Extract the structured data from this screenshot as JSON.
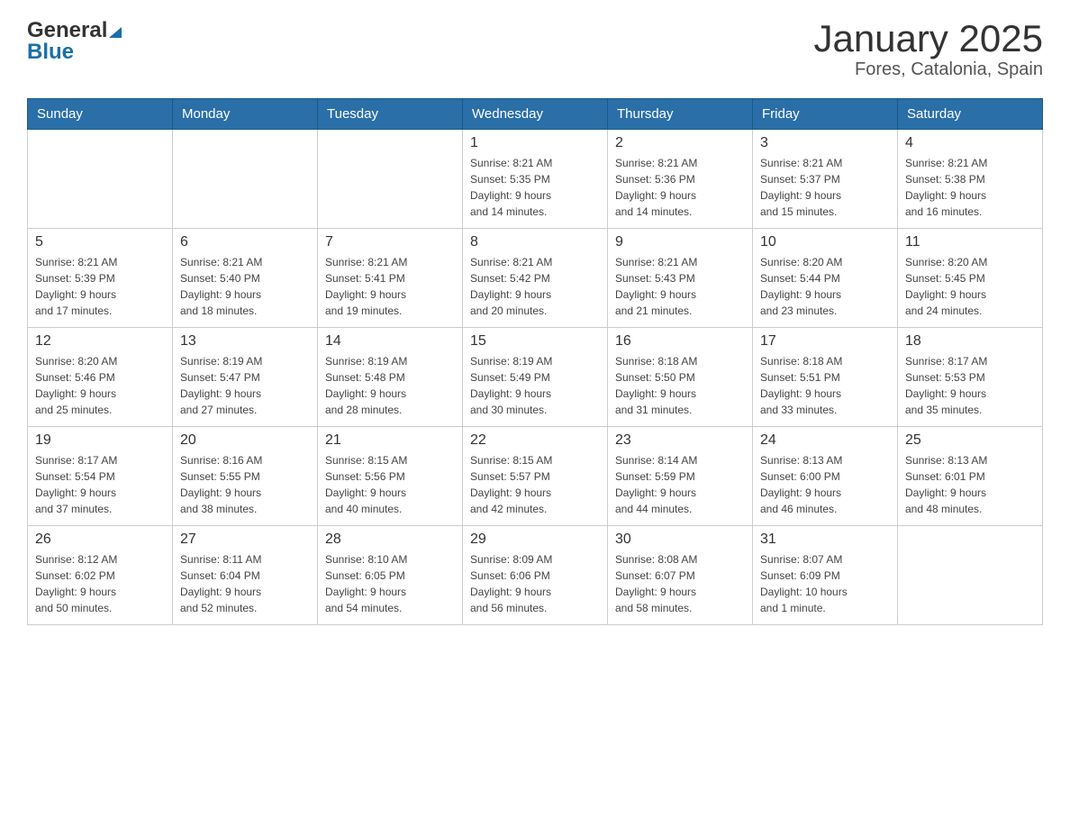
{
  "header": {
    "logo": {
      "general": "General",
      "blue": "Blue"
    },
    "title": "January 2025",
    "subtitle": "Fores, Catalonia, Spain"
  },
  "weekdays": [
    "Sunday",
    "Monday",
    "Tuesday",
    "Wednesday",
    "Thursday",
    "Friday",
    "Saturday"
  ],
  "weeks": [
    [
      {
        "day": "",
        "info": ""
      },
      {
        "day": "",
        "info": ""
      },
      {
        "day": "",
        "info": ""
      },
      {
        "day": "1",
        "info": "Sunrise: 8:21 AM\nSunset: 5:35 PM\nDaylight: 9 hours\nand 14 minutes."
      },
      {
        "day": "2",
        "info": "Sunrise: 8:21 AM\nSunset: 5:36 PM\nDaylight: 9 hours\nand 14 minutes."
      },
      {
        "day": "3",
        "info": "Sunrise: 8:21 AM\nSunset: 5:37 PM\nDaylight: 9 hours\nand 15 minutes."
      },
      {
        "day": "4",
        "info": "Sunrise: 8:21 AM\nSunset: 5:38 PM\nDaylight: 9 hours\nand 16 minutes."
      }
    ],
    [
      {
        "day": "5",
        "info": "Sunrise: 8:21 AM\nSunset: 5:39 PM\nDaylight: 9 hours\nand 17 minutes."
      },
      {
        "day": "6",
        "info": "Sunrise: 8:21 AM\nSunset: 5:40 PM\nDaylight: 9 hours\nand 18 minutes."
      },
      {
        "day": "7",
        "info": "Sunrise: 8:21 AM\nSunset: 5:41 PM\nDaylight: 9 hours\nand 19 minutes."
      },
      {
        "day": "8",
        "info": "Sunrise: 8:21 AM\nSunset: 5:42 PM\nDaylight: 9 hours\nand 20 minutes."
      },
      {
        "day": "9",
        "info": "Sunrise: 8:21 AM\nSunset: 5:43 PM\nDaylight: 9 hours\nand 21 minutes."
      },
      {
        "day": "10",
        "info": "Sunrise: 8:20 AM\nSunset: 5:44 PM\nDaylight: 9 hours\nand 23 minutes."
      },
      {
        "day": "11",
        "info": "Sunrise: 8:20 AM\nSunset: 5:45 PM\nDaylight: 9 hours\nand 24 minutes."
      }
    ],
    [
      {
        "day": "12",
        "info": "Sunrise: 8:20 AM\nSunset: 5:46 PM\nDaylight: 9 hours\nand 25 minutes."
      },
      {
        "day": "13",
        "info": "Sunrise: 8:19 AM\nSunset: 5:47 PM\nDaylight: 9 hours\nand 27 minutes."
      },
      {
        "day": "14",
        "info": "Sunrise: 8:19 AM\nSunset: 5:48 PM\nDaylight: 9 hours\nand 28 minutes."
      },
      {
        "day": "15",
        "info": "Sunrise: 8:19 AM\nSunset: 5:49 PM\nDaylight: 9 hours\nand 30 minutes."
      },
      {
        "day": "16",
        "info": "Sunrise: 8:18 AM\nSunset: 5:50 PM\nDaylight: 9 hours\nand 31 minutes."
      },
      {
        "day": "17",
        "info": "Sunrise: 8:18 AM\nSunset: 5:51 PM\nDaylight: 9 hours\nand 33 minutes."
      },
      {
        "day": "18",
        "info": "Sunrise: 8:17 AM\nSunset: 5:53 PM\nDaylight: 9 hours\nand 35 minutes."
      }
    ],
    [
      {
        "day": "19",
        "info": "Sunrise: 8:17 AM\nSunset: 5:54 PM\nDaylight: 9 hours\nand 37 minutes."
      },
      {
        "day": "20",
        "info": "Sunrise: 8:16 AM\nSunset: 5:55 PM\nDaylight: 9 hours\nand 38 minutes."
      },
      {
        "day": "21",
        "info": "Sunrise: 8:15 AM\nSunset: 5:56 PM\nDaylight: 9 hours\nand 40 minutes."
      },
      {
        "day": "22",
        "info": "Sunrise: 8:15 AM\nSunset: 5:57 PM\nDaylight: 9 hours\nand 42 minutes."
      },
      {
        "day": "23",
        "info": "Sunrise: 8:14 AM\nSunset: 5:59 PM\nDaylight: 9 hours\nand 44 minutes."
      },
      {
        "day": "24",
        "info": "Sunrise: 8:13 AM\nSunset: 6:00 PM\nDaylight: 9 hours\nand 46 minutes."
      },
      {
        "day": "25",
        "info": "Sunrise: 8:13 AM\nSunset: 6:01 PM\nDaylight: 9 hours\nand 48 minutes."
      }
    ],
    [
      {
        "day": "26",
        "info": "Sunrise: 8:12 AM\nSunset: 6:02 PM\nDaylight: 9 hours\nand 50 minutes."
      },
      {
        "day": "27",
        "info": "Sunrise: 8:11 AM\nSunset: 6:04 PM\nDaylight: 9 hours\nand 52 minutes."
      },
      {
        "day": "28",
        "info": "Sunrise: 8:10 AM\nSunset: 6:05 PM\nDaylight: 9 hours\nand 54 minutes."
      },
      {
        "day": "29",
        "info": "Sunrise: 8:09 AM\nSunset: 6:06 PM\nDaylight: 9 hours\nand 56 minutes."
      },
      {
        "day": "30",
        "info": "Sunrise: 8:08 AM\nSunset: 6:07 PM\nDaylight: 9 hours\nand 58 minutes."
      },
      {
        "day": "31",
        "info": "Sunrise: 8:07 AM\nSunset: 6:09 PM\nDaylight: 10 hours\nand 1 minute."
      },
      {
        "day": "",
        "info": ""
      }
    ]
  ]
}
